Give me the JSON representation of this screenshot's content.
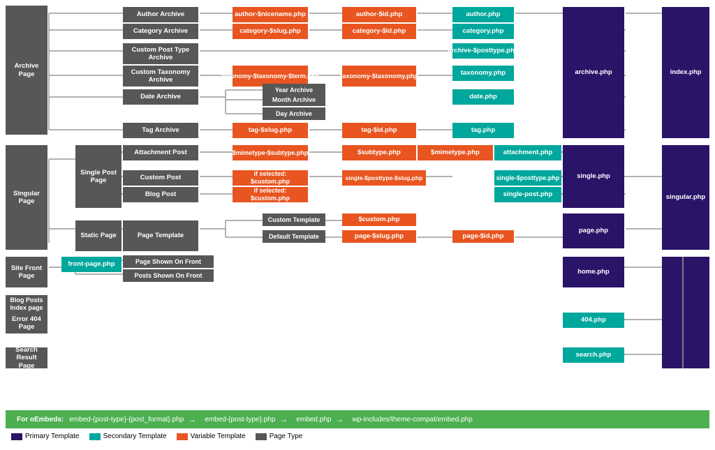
{
  "colors": {
    "page_type": "#575757",
    "variable": "#e85520",
    "primary": "#2a1468",
    "secondary": "#00a79d",
    "line": "#aaa",
    "embed_bg": "#4caf50"
  },
  "legend": {
    "primary_label": "Primary Template",
    "secondary_label": "Secondary Template",
    "variable_label": "Variable Template",
    "page_type_label": "Page Type"
  },
  "embed": {
    "label": "For oEmbeds:",
    "items": [
      "embed-{post-type}-{post_format}.php",
      "embed-{post-type}.php",
      "embed.php",
      "wp-includes/theme-compat/embed.php"
    ]
  },
  "nodes": {
    "archive_page": "Archive Page",
    "author_archive": "Author Archive",
    "category_archive": "Category Archive",
    "custom_post_type_archive": "Custom Post Type Archive",
    "custom_taxonomy_archive": "Custom Taxonomy Archive",
    "date_archive": "Date Archive",
    "year_archive": "Year Archive",
    "month_archive": "Month Archive",
    "day_archive": "Day Archive",
    "tag_archive": "Tag Archive",
    "author_nicename": "author-$nicename.php",
    "author_id": "author-$id.php",
    "author_php": "author.php",
    "category_slug": "category-$slug.php",
    "category_id": "category-$id.php",
    "category_php": "category.php",
    "archive_posttype": "archive-$posttype.php",
    "taxonomy_term": "taxonomy-$taxonomy-$term.php",
    "taxonomy_taxonomy": "taxonomy-$taxonomy.php",
    "taxonomy_php": "taxonomy.php",
    "date_php": "date.php",
    "tag_slug": "tag-$slug.php",
    "tag_id": "tag-$id.php",
    "tag_php": "tag.php",
    "archive_php": "archive.php",
    "index_php": "index.php",
    "singular_page": "Singular Page",
    "single_post_page": "Single Post Page",
    "attachment_post": "Attachment Post",
    "custom_post": "Custom Post",
    "blog_post": "Blog Post",
    "static_page": "Static Page",
    "page_template": "Page Template",
    "custom_template": "Custom Template",
    "default_template": "Default Template",
    "mimetype_subtype": "$mimetype-$subtype.php",
    "subtype_php": "$subtype.php",
    "mimetype_php": "$mimetype.php",
    "attachment_php": "attachment.php",
    "if_selected_custom1": "if selected: $custom.php",
    "single_posttype_slug": "single-$posttype-$slug.php",
    "single_posttype": "single-$posttype.php",
    "if_selected_custom2": "if selected: $custom.php",
    "single_post_php": "single-post.php",
    "custom_php": "$custom.php",
    "page_slug": "page-$slug.php",
    "page_id": "page-$id.php",
    "single_php": "single.php",
    "page_php": "page.php",
    "singular_php": "singular.php",
    "site_front_page": "Site Front Page",
    "front_page_php": "front-page.php",
    "page_shown_on_front": "Page Shown On Front",
    "posts_shown_on_front": "Posts Shown On Front",
    "home_php": "home.php",
    "blog_posts_index": "Blog Posts Index page",
    "error_404_page": "Error 404 Page",
    "e404_php": "404.php",
    "search_result_page": "Search Result Page",
    "search_php": "search.php"
  }
}
